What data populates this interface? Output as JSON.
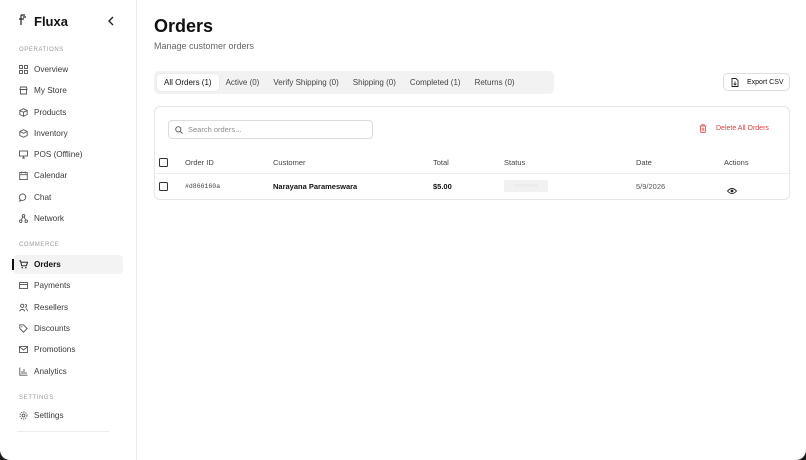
{
  "app": {
    "name": "Fluxa"
  },
  "sidebar": {
    "sections": [
      {
        "label": "OPERATIONS"
      },
      {
        "label": "COMMERCE"
      },
      {
        "label": "SETTINGS"
      }
    ],
    "items": [
      {
        "label": "Overview",
        "icon": "grid-icon"
      },
      {
        "label": "My Store",
        "icon": "store-icon"
      },
      {
        "label": "Products",
        "icon": "package-icon"
      },
      {
        "label": "Inventory",
        "icon": "box-icon"
      },
      {
        "label": "POS (Offline)",
        "icon": "monitor-icon"
      },
      {
        "label": "Calendar",
        "icon": "calendar-icon"
      },
      {
        "label": "Chat",
        "icon": "chat-icon"
      },
      {
        "label": "Network",
        "icon": "network-icon"
      },
      {
        "label": "Orders",
        "icon": "cart-icon",
        "active": true
      },
      {
        "label": "Payments",
        "icon": "credit-card-icon"
      },
      {
        "label": "Resellers",
        "icon": "users-icon"
      },
      {
        "label": "Discounts",
        "icon": "tag-icon"
      },
      {
        "label": "Promotions",
        "icon": "mail-icon"
      },
      {
        "label": "Analytics",
        "icon": "bar-chart-icon"
      },
      {
        "label": "Settings",
        "icon": "gear-icon"
      }
    ]
  },
  "header": {
    "title": "Orders",
    "subtitle": "Manage customer orders"
  },
  "tabs": [
    {
      "label": "All Orders (1)",
      "active": true
    },
    {
      "label": "Active (0)"
    },
    {
      "label": "Verify Shipping (0)"
    },
    {
      "label": "Shipping (0)"
    },
    {
      "label": "Completed (1)"
    },
    {
      "label": "Returns (0)"
    }
  ],
  "toolbar": {
    "export_label": "Export CSV",
    "search_placeholder": "Search orders...",
    "delete_all_label": "Delete All Orders"
  },
  "table": {
    "columns": [
      "Order ID",
      "Customer",
      "Total",
      "Status",
      "Date",
      "Actions"
    ],
    "rows": [
      {
        "order_id": "#d866160a",
        "customer": "Narayana Parameswara",
        "total": "$5.00",
        "status": "completed",
        "date": "5/9/2026"
      }
    ]
  },
  "colors": {
    "accent": "#111111",
    "danger": "#d94040",
    "muted": "#9a9a9a"
  }
}
